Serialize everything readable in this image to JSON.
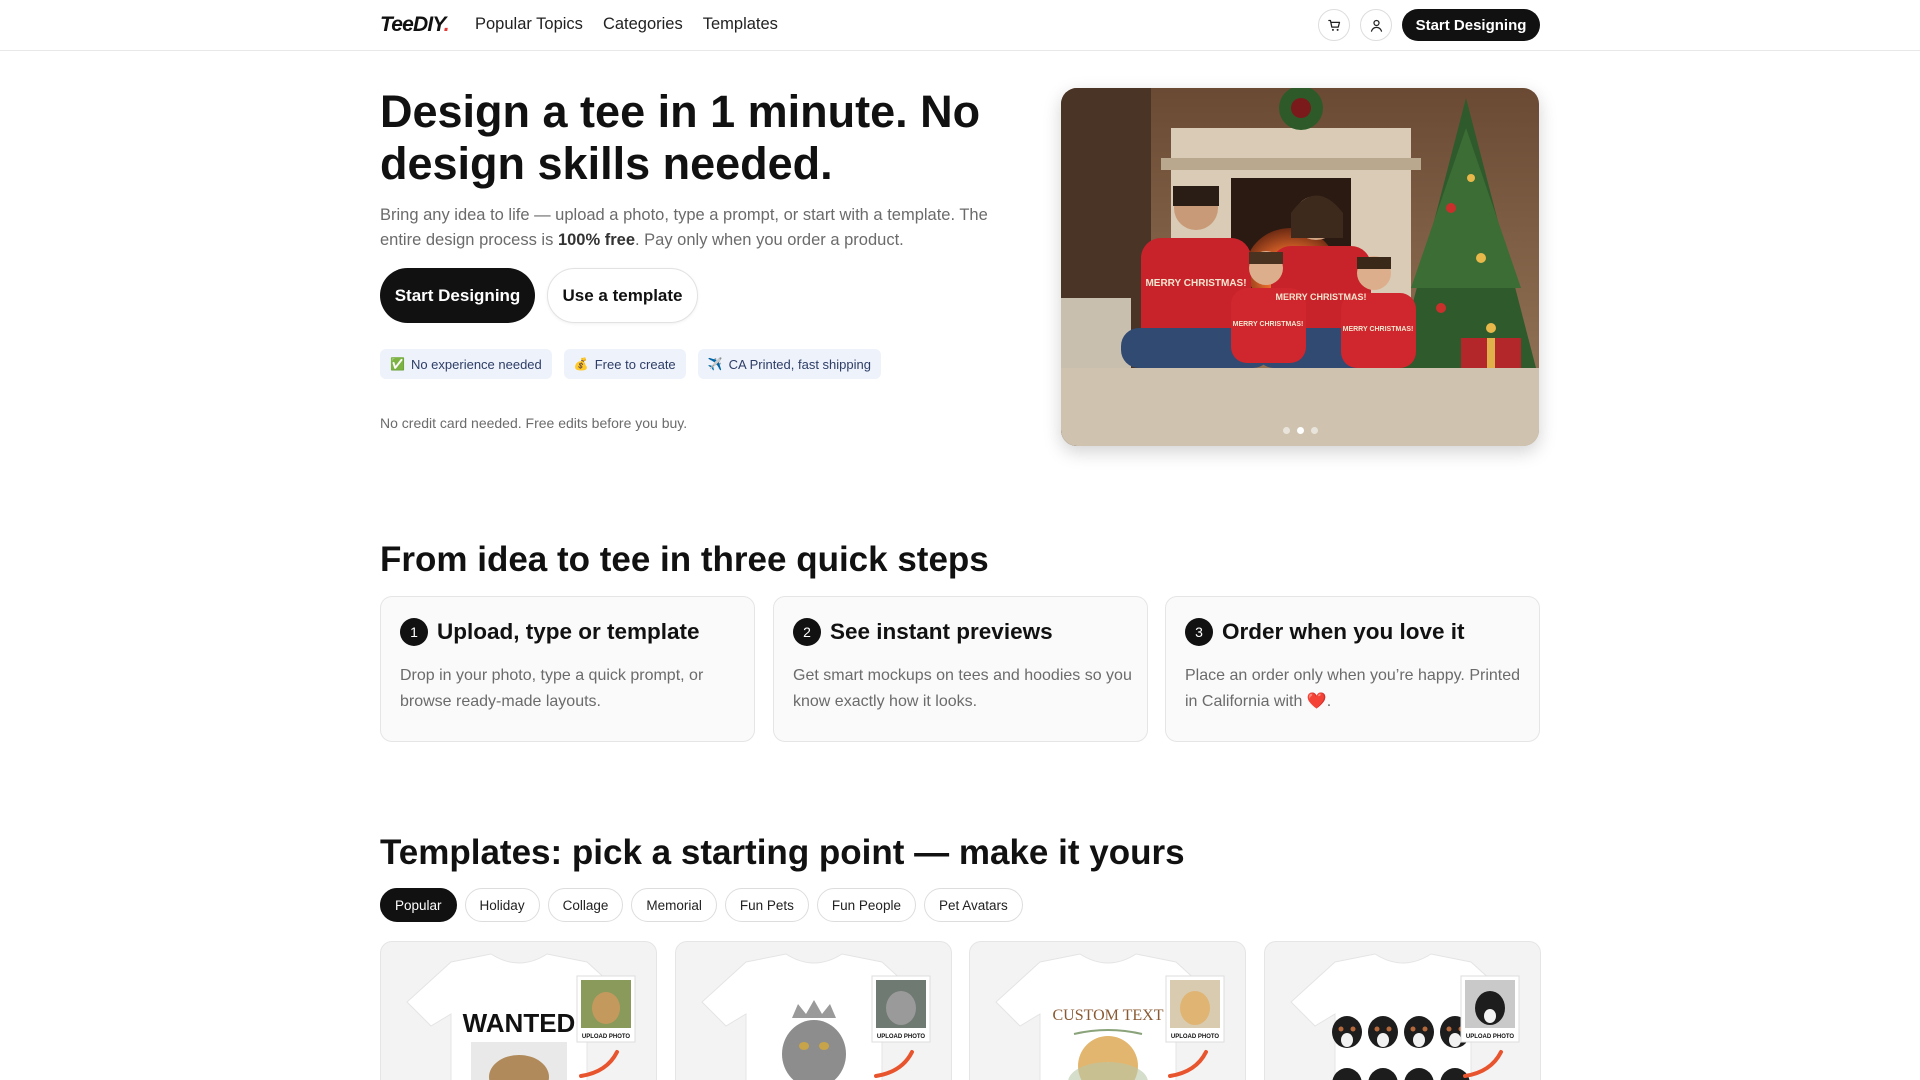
{
  "header": {
    "logo_text": "TeeDIY",
    "logo_dot": ".",
    "nav": [
      "Popular Topics",
      "Categories",
      "Templates"
    ],
    "cart_icon": "cart-icon",
    "account_icon": "user-icon",
    "cta_label": "Start Designing"
  },
  "hero": {
    "title": "Design a tee in 1 minute. No design skills needed.",
    "desc_before": "Bring any idea to life — upload a photo, type a prompt, or start with a template. The entire design process is ",
    "desc_bold": "100% free",
    "desc_after": ". Pay only when you order a product.",
    "primary_button": "Start Designing",
    "secondary_button": "Use a template",
    "badges": [
      {
        "icon": "✅",
        "label": "No experience needed"
      },
      {
        "icon": "💰",
        "label": "Free to create"
      },
      {
        "icon": "✈️",
        "label": "CA Printed, fast shipping"
      }
    ],
    "note": "No credit card needed. Free edits before you buy.",
    "carousel": {
      "slides": 3,
      "active_index": 1
    },
    "image_shirt_text": "MERRY CHRISTMAS!"
  },
  "steps": {
    "title": "From idea to tee in three quick steps",
    "items": [
      {
        "num": "1",
        "title": "Upload, type or template",
        "desc": "Drop in your photo, type a quick prompt, or browse ready-made layouts."
      },
      {
        "num": "2",
        "title": "See instant previews",
        "desc": "Get smart mockups on tees and hoodies so you know exactly how it looks."
      },
      {
        "num": "3",
        "title": "Order when you love it",
        "desc_before": "Place an order only when you’re happy. Printed in California with ",
        "heart": "❤️",
        "desc_after": "."
      }
    ]
  },
  "templates": {
    "title": "Templates: pick a starting point — make it yours",
    "tabs": [
      "Popular",
      "Holiday",
      "Collage",
      "Memorial",
      "Fun Pets",
      "Fun People",
      "Pet Avatars"
    ],
    "active_tab": "Popular",
    "cards": [
      {
        "shirt_text": "WANTED",
        "upload_label": "UPLOAD PHOTO"
      },
      {
        "shirt_text": "",
        "upload_label": "UPLOAD PHOTO"
      },
      {
        "shirt_text": "CUSTOM TEXT",
        "upload_label": "UPLOAD PHOTO"
      },
      {
        "shirt_text": "",
        "upload_label": "UPLOAD PHOTO"
      }
    ]
  },
  "colors": {
    "primary": "#111111",
    "muted_text": "#6b6b6b",
    "badge_bg": "#eef2fb",
    "accent_red": "#d32f2f"
  }
}
